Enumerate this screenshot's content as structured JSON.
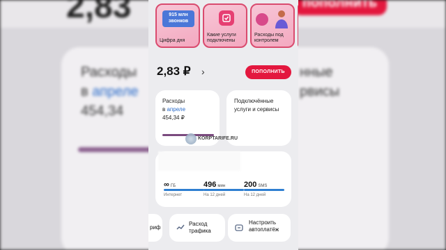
{
  "background": {
    "amount": "2,83",
    "top_button": "пополнить",
    "expenses_line1": "Расходы",
    "expenses_in": "в ",
    "expenses_month": "апреле",
    "expenses_amount": "454,34",
    "services_line1": "нные",
    "services_line2": "рвисы"
  },
  "stories": [
    {
      "promo": "915 млн звонков",
      "label": "Цифра дня"
    },
    {
      "label": "Какие услуги подключены"
    },
    {
      "label": "Расходы под контролем"
    }
  ],
  "balance": {
    "amount": "2,83 ₽",
    "topup_label": "пополнить"
  },
  "expenses_card": {
    "title": "Расходы",
    "in": "в ",
    "month": "апреле",
    "amount": "454,34 ₽"
  },
  "services_card": {
    "title": "Подключённые услуги и сервисы"
  },
  "watermark": "KORPTARIFE.RU",
  "stats": [
    {
      "value": "∞",
      "unit": "ГБ",
      "caption": "Интернет"
    },
    {
      "value": "496",
      "unit": "мин",
      "caption": "На 12 дней"
    },
    {
      "value": "200",
      "unit": "SMS",
      "caption": "На 12 дней"
    }
  ],
  "actions": [
    {
      "label": "риф"
    },
    {
      "label": "Расход трафика"
    },
    {
      "label": "Настроить автоплатёж"
    }
  ],
  "colors": {
    "accent": "#e3173e",
    "link": "#2a6bc9",
    "bar": "#2f7fd1"
  }
}
